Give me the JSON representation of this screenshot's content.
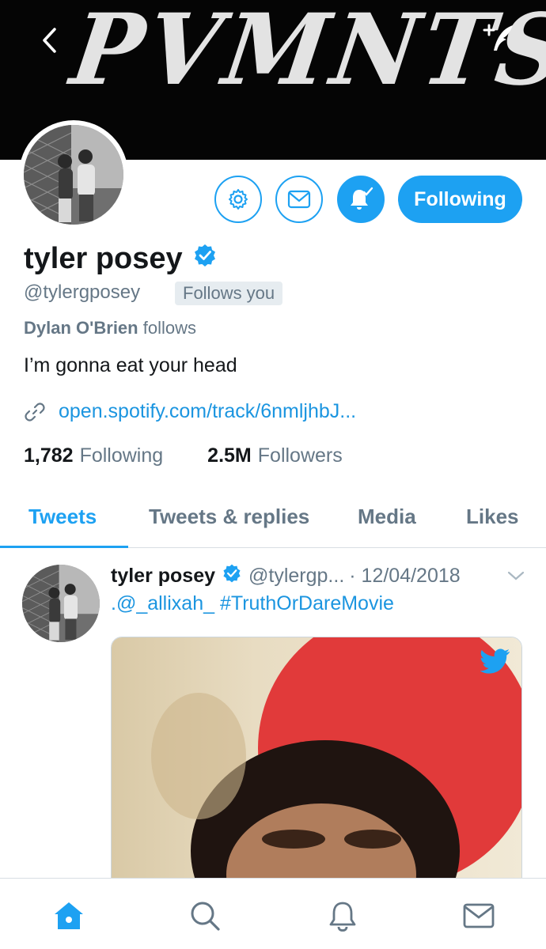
{
  "header": {
    "banner_text": "PVMNTS"
  },
  "profile": {
    "name": "tyler posey",
    "handle": "@tylergposey",
    "follows_you": "Follows you",
    "social_context_name": "Dylan O'Brien",
    "social_context_suffix": " follows",
    "bio": "I’m gonna eat your head",
    "link": "open.spotify.com/track/6nmljhbJ...",
    "following_count": "1,782",
    "following_label": "Following",
    "followers_count": "2.5M",
    "followers_label": "Followers"
  },
  "actions": {
    "following_button": "Following"
  },
  "tabs": [
    {
      "label": "Tweets",
      "active": true
    },
    {
      "label": "Tweets & replies",
      "active": false
    },
    {
      "label": "Media",
      "active": false
    },
    {
      "label": "Likes",
      "active": false
    }
  ],
  "tweet": {
    "name": "tyler posey",
    "handle": "@tylergp...",
    "date": "· 12/04/2018",
    "text": ".@_allixah_ #TruthOrDareMovie"
  },
  "colors": {
    "accent": "#1da1f2",
    "link": "#1b95e0",
    "muted": "#657786"
  },
  "icons": [
    "back-icon",
    "compose-icon",
    "gear-icon",
    "mail-icon",
    "bell-check-icon",
    "verified-icon",
    "link-icon",
    "chevron-down-icon",
    "twitter-bird-icon",
    "home-icon",
    "search-icon",
    "notifications-icon",
    "messages-icon"
  ]
}
